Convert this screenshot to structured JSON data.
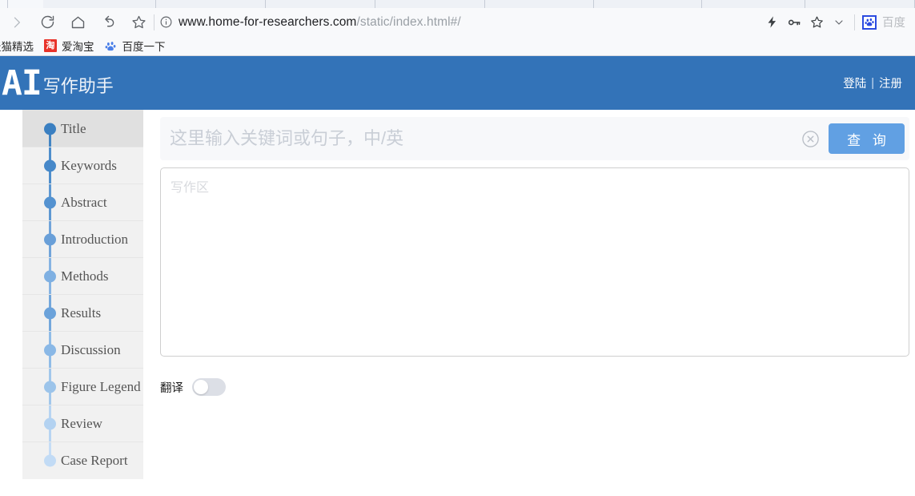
{
  "browser": {
    "nav_icons": [
      "forward-arrow",
      "reload",
      "home",
      "back-arrow",
      "bookmark-star"
    ],
    "url": {
      "host": "www.home-for-researchers.com",
      "path": "/static/index.html#/",
      "security_icon": "info-circle"
    },
    "right_icons": [
      "lightning-icon",
      "key-icon",
      "star-icon",
      "chevron-down-icon"
    ],
    "extension": {
      "icon": "baidu-paw-icon",
      "label": "百度"
    },
    "bookmarks": [
      {
        "label": "天猫精选",
        "icon": ""
      },
      {
        "label": "爱淘宝",
        "icon": "taobao-icon"
      },
      {
        "label": "百度一下",
        "icon": "baidu-paw-icon"
      }
    ]
  },
  "header": {
    "brand_ai": "AI",
    "brand_cn": "写作助手",
    "login_label": "登陆",
    "separator": "|",
    "register_label": "注册",
    "bg_color": "#3373b8"
  },
  "sidebar": {
    "items": [
      {
        "label": "Title",
        "dot_color": "#3a7fc1",
        "active": true
      },
      {
        "label": "Keywords",
        "dot_color": "#4688c9",
        "active": false
      },
      {
        "label": "Abstract",
        "dot_color": "#5492d0",
        "active": false
      },
      {
        "label": "Introduction",
        "dot_color": "#699fd8",
        "active": false
      },
      {
        "label": "Methods",
        "dot_color": "#7fb0e2",
        "active": false
      },
      {
        "label": "Results",
        "dot_color": "#6ba2da",
        "active": false
      },
      {
        "label": "Discussion",
        "dot_color": "#8ab8e6",
        "active": false
      },
      {
        "label": "Figure Legend",
        "dot_color": "#9cc4ea",
        "active": false
      },
      {
        "label": "Review",
        "dot_color": "#b3d2f1",
        "active": false
      },
      {
        "label": "Case Report",
        "dot_color": "#c2dbf5",
        "active": false
      }
    ]
  },
  "main": {
    "search": {
      "placeholder": "这里输入关键词或句子，中/英",
      "value": "",
      "clear_icon": "clear-circle-icon",
      "query_label": "查 询",
      "query_color": "#61a0e3"
    },
    "editor": {
      "placeholder": "写作区",
      "value": ""
    },
    "translate": {
      "label": "翻译",
      "enabled": false
    }
  }
}
